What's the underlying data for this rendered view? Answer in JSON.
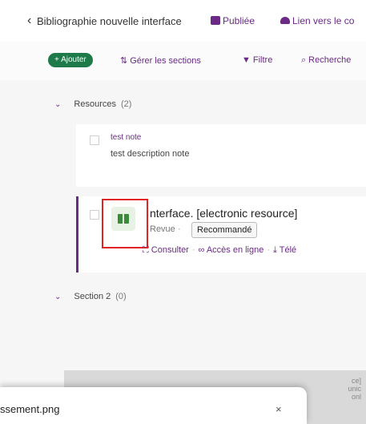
{
  "header": {
    "back_icon": "chevron-left-icon",
    "title": "Bibliographie nouvelle interface",
    "status_label": "Publiée",
    "course_link_label": "Lien vers le co"
  },
  "toolbar": {
    "add_label": "+ Ajouter",
    "manage_label": "Gérer les sections",
    "filter_label": "Filtre",
    "search_label": "Recherche"
  },
  "sections": [
    {
      "label": "Resources",
      "count": "(2)"
    },
    {
      "label": "Section 2",
      "count": "(0)"
    }
  ],
  "note": {
    "title": "test note",
    "description": "test description note"
  },
  "resource": {
    "title": "nterface. [electronic resource]",
    "type": "Revue",
    "badge": "Recommandé",
    "actions": {
      "consult": "Consulter",
      "online": "Accès en ligne",
      "download": "Télé"
    }
  },
  "bottom_preview_text": "ce]\nunic\nonl",
  "download": {
    "filename": "ssement.png",
    "close_label": "×"
  },
  "colors": {
    "accent": "#6b2a86",
    "add_button": "#1f7a4a",
    "highlight_box": "#e02424"
  }
}
